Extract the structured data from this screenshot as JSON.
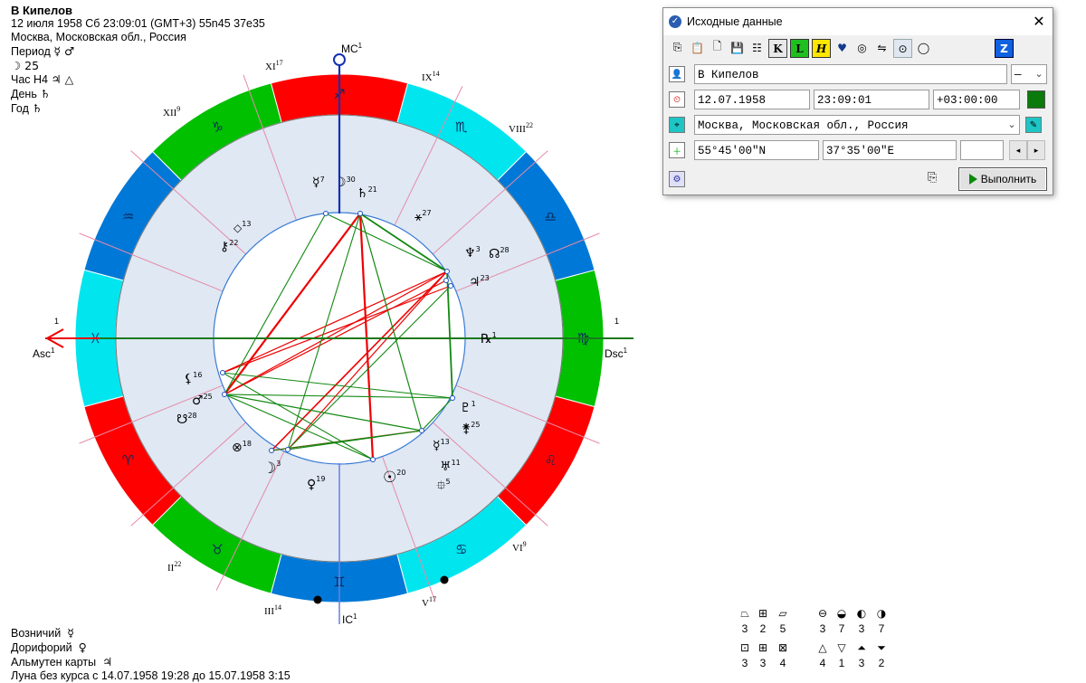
{
  "header": {
    "name": "В Кипелов",
    "line1": "12 июля 1958  Сб  23:09:01 (GMT+3) 55n45  37e35",
    "line2": "Москва, Московская обл., Россия",
    "period_label": "Период",
    "period_value": "☿ ♂",
    "moon_value": "☽  25",
    "hour_label": "Час Н4",
    "hour_value": "♃ △",
    "day_label": "День",
    "day_value": "♄",
    "year_label": "Год",
    "year_value": "♄"
  },
  "footer": {
    "vozn_label": "Возничий",
    "vozn_value": "☿",
    "dorif_label": "Дорифорий",
    "dorif_value": "♀",
    "almuten_label": "Альмутен карты",
    "almuten_value": "♃",
    "moon_course": "Луна без курса с 14.07.1958 19:28 до 15.07.1958  3:15"
  },
  "chart": {
    "asc_label": "Asc",
    "asc_sup": "1",
    "dsc_label": "Dsc",
    "dsc_sup": "1",
    "mc_label": "MC",
    "mc_sup": "1",
    "ic_label": "IC",
    "ic_sup": "1",
    "asc_num": "1",
    "dsc_num": "1",
    "houses": [
      {
        "label": "II",
        "sup": "22"
      },
      {
        "label": "III",
        "sup": "14"
      },
      {
        "label": "V",
        "sup": "17"
      },
      {
        "label": "VI",
        "sup": "9"
      },
      {
        "label": "VIII",
        "sup": "22"
      },
      {
        "label": "IX",
        "sup": "14"
      },
      {
        "label": "XI",
        "sup": "17"
      },
      {
        "label": "XII",
        "sup": "9"
      }
    ],
    "signs": [
      "♈",
      "♉",
      "♊",
      "♋",
      "♌",
      "♍",
      "♎",
      "♏",
      "♐",
      "♑",
      "♒",
      "♓"
    ],
    "sign_colors": {
      "fire": "#ff0000",
      "earth": "#00c000",
      "air": "#0078d7",
      "water": "#00e5ee"
    },
    "planets": [
      {
        "glyph": "☿",
        "deg": "7"
      },
      {
        "glyph": "☽",
        "deg": "30"
      },
      {
        "glyph": "♄",
        "deg": "21",
        "retro": "R"
      },
      {
        "glyph": "⚹",
        "deg": "27"
      },
      {
        "glyph": "♆",
        "deg": "3",
        "retro": "R"
      },
      {
        "glyph": "☊",
        "deg": "28"
      },
      {
        "glyph": "♃",
        "deg": "23"
      },
      {
        "glyph": "℞",
        "deg": "1"
      },
      {
        "glyph": "♇",
        "deg": "1"
      },
      {
        "glyph": "⚵",
        "deg": "25"
      },
      {
        "glyph": "☿",
        "deg": "13"
      },
      {
        "glyph": "♅",
        "deg": "11"
      },
      {
        "glyph": "⯐",
        "deg": "5"
      },
      {
        "glyph": "☉",
        "deg": "20"
      },
      {
        "glyph": "♀",
        "deg": "19"
      },
      {
        "glyph": "☽",
        "deg": "3"
      },
      {
        "glyph": "⊗",
        "deg": "18"
      },
      {
        "glyph": "☋",
        "deg": "28"
      },
      {
        "glyph": "♂",
        "deg": "25"
      },
      {
        "glyph": "⚸",
        "deg": "16"
      },
      {
        "glyph": "⚷",
        "deg": "22",
        "retro": "R"
      },
      {
        "glyph": "◇",
        "deg": "13"
      }
    ]
  },
  "dialog": {
    "title": "Исходные данные",
    "close": "✕",
    "name_value": "В Кипелов",
    "gender_value": "—",
    "date_value": "12.07.1958",
    "time_value": "23:09:01",
    "tz_value": "+03:00:00",
    "place_value": "Москва, Московская обл., Россия",
    "lat_value": "55°45'00\"N",
    "lon_value": "37°35'00\"E",
    "run_label": "Выполнить",
    "tb": {
      "k": "K",
      "l": "L",
      "h": "H",
      "z": "Z"
    }
  },
  "stats": [
    {
      "glyph": "⏢",
      "value": "3"
    },
    {
      "glyph": "⊞",
      "value": "2"
    },
    {
      "glyph": "⏥",
      "value": "5"
    },
    {
      "glyph": "⊖",
      "value": "3"
    },
    {
      "glyph": "◒",
      "value": "7"
    },
    {
      "glyph": "◐",
      "value": "3"
    },
    {
      "glyph": "◑",
      "value": "7"
    },
    {
      "glyph": "⊡",
      "value": "3"
    },
    {
      "glyph": "⊞",
      "value": "3"
    },
    {
      "glyph": "⊠",
      "value": "4"
    },
    {
      "glyph": "△",
      "value": "4"
    },
    {
      "glyph": "▽",
      "value": "1"
    },
    {
      "glyph": "⏶",
      "value": "3"
    },
    {
      "glyph": "⏷",
      "value": "2"
    }
  ]
}
